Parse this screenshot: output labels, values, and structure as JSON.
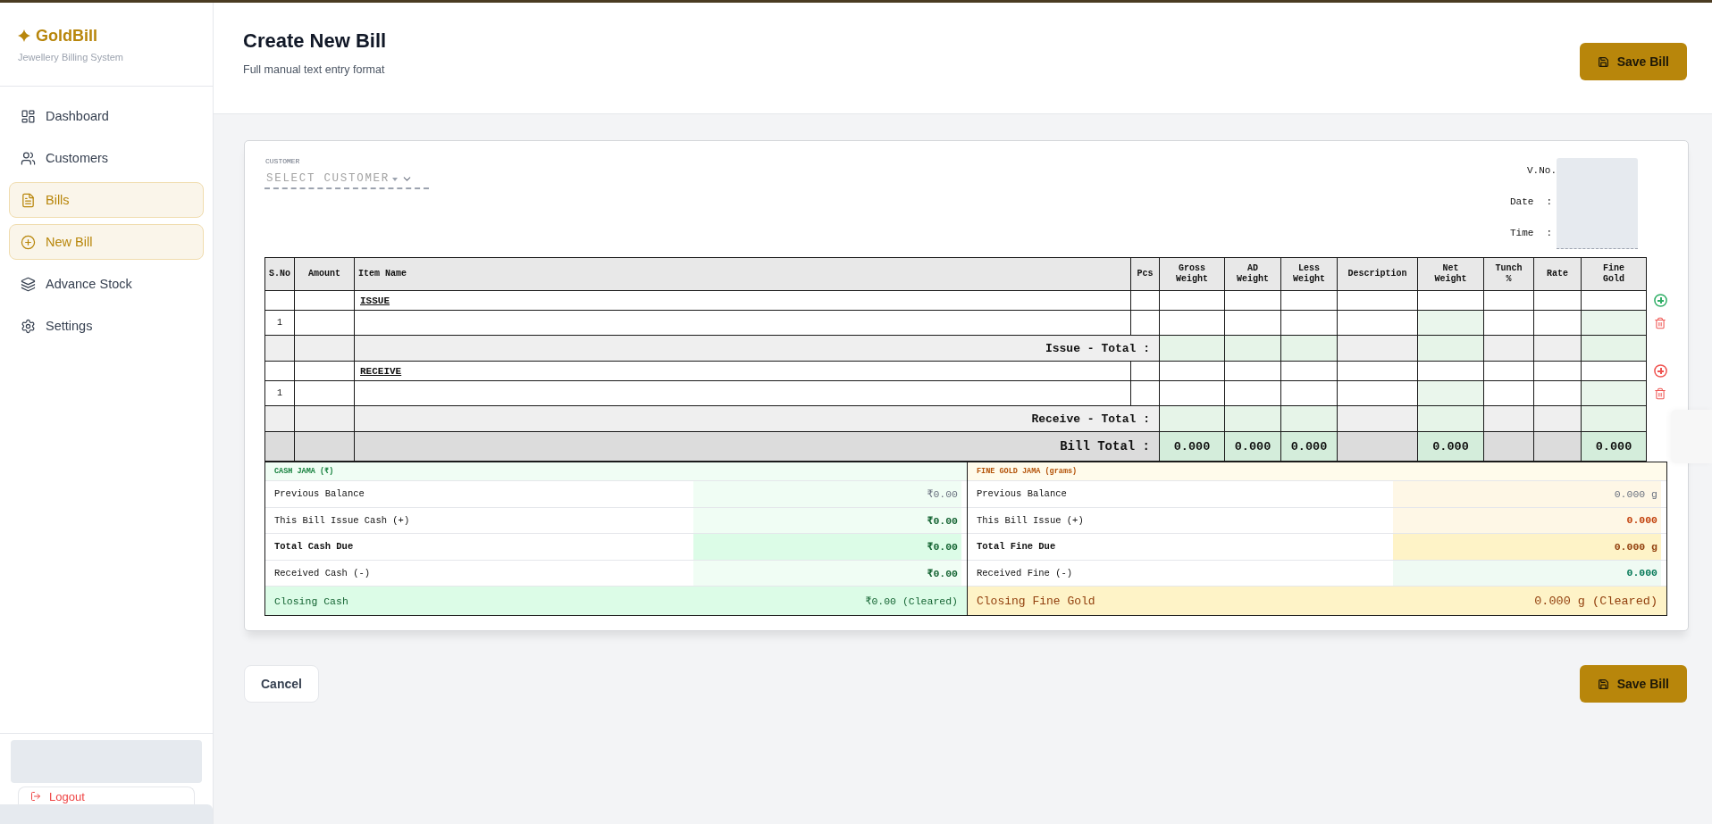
{
  "sidebar": {
    "brand": {
      "name": "GoldBill",
      "tagline": "Jewellery Billing System"
    },
    "items": [
      {
        "label": "Dashboard",
        "selected": false
      },
      {
        "label": "Customers",
        "selected": false
      },
      {
        "label": "Bills",
        "selected": true
      },
      {
        "label": "New Bill",
        "selected": true
      },
      {
        "label": "Advance Stock",
        "selected": false
      },
      {
        "label": "Settings",
        "selected": false
      }
    ],
    "logout": "Logout"
  },
  "header": {
    "title": "Create New Bill",
    "subtitle": "Full manual text entry format",
    "save_button": "Save Bill"
  },
  "bill": {
    "customer": {
      "label": "CUSTOMER",
      "placeholder": "SELECT CUSTOMER"
    },
    "details": [
      {
        "label": "V.No."
      },
      {
        "label": "Date",
        "separator": ":"
      },
      {
        "label": "Time",
        "separator": ":"
      }
    ],
    "table": {
      "columns": [
        "S.No",
        "Amount",
        "Item Name",
        "Pcs",
        "Gross Weight",
        "AD Weight",
        "Less Weight",
        "Description",
        "Net Weight",
        "Tunch %",
        "Rate",
        "Fine Gold"
      ],
      "sections": [
        {
          "title": "ISSUE",
          "color": "#2fae66",
          "rows": [
            {
              "s_no": "1"
            }
          ],
          "total_label": "Issue - Total :"
        },
        {
          "title": "RECEIVE",
          "color": "#ef5350",
          "rows": [
            {
              "s_no": "1"
            }
          ],
          "total_label": "Receive - Total :"
        }
      ],
      "bill_total": {
        "label": "Bill Total :",
        "gross_weight": "0.000",
        "ad_weight": "0.000",
        "less_weight": "0.000",
        "net_weight": "0.000",
        "fine_gold": "0.000"
      }
    },
    "jama": [
      {
        "kind": "cash",
        "title": "CASH JAMA (₹)",
        "rows": [
          {
            "kind": "previous",
            "label": "Previous Balance",
            "value": "₹0.00"
          },
          {
            "kind": "issue",
            "label": "This Bill Issue Cash (+)",
            "value": "₹0.00"
          },
          {
            "kind": "due",
            "label": "Total Cash Due",
            "value": "₹0.00"
          },
          {
            "kind": "received",
            "label": "Received Cash (-)",
            "value": "₹0.00"
          }
        ],
        "closing": {
          "label": "Closing Cash",
          "value": "₹0.00 (Cleared)"
        }
      },
      {
        "kind": "gold",
        "title": "FINE GOLD JAMA (grams)",
        "rows": [
          {
            "kind": "previous",
            "label": "Previous Balance",
            "value": "0.000 g"
          },
          {
            "kind": "issue",
            "label": "This Bill Issue (+)",
            "value": "0.000"
          },
          {
            "kind": "due",
            "label": "Total Fine Due",
            "value": "0.000 g"
          },
          {
            "kind": "received",
            "label": "Received Fine (-)",
            "value": "0.000"
          }
        ],
        "closing": {
          "label": "Closing Fine Gold",
          "value": "0.000 g (Cleared)"
        }
      }
    ]
  },
  "footer": {
    "cancel_button": "Cancel",
    "save_button": "Save Bill"
  }
}
